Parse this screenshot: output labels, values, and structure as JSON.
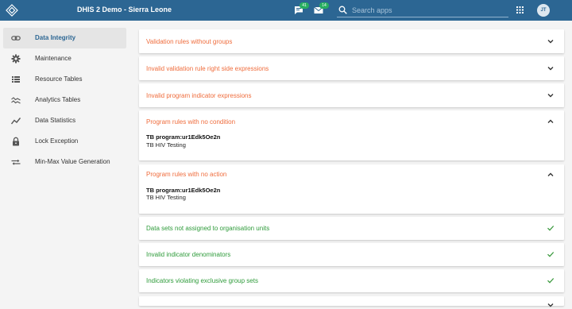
{
  "header": {
    "title": "DHIS 2 Demo - Sierra Leone",
    "messages_count": "41",
    "interpretations_count": "14",
    "search_placeholder": "Search apps",
    "user_initials": "JT"
  },
  "sidebar": {
    "items": [
      {
        "label": "Data Integrity",
        "icon": "link-icon",
        "active": true
      },
      {
        "label": "Maintenance",
        "icon": "gear-icon"
      },
      {
        "label": "Resource Tables",
        "icon": "list-icon"
      },
      {
        "label": "Analytics Tables",
        "icon": "trending-icon"
      },
      {
        "label": "Data Statistics",
        "icon": "chart-line-icon"
      },
      {
        "label": "Lock Exception",
        "icon": "lock-icon"
      },
      {
        "label": "Min-Max Value Generation",
        "icon": "compare-arrows-icon"
      }
    ]
  },
  "checks": [
    {
      "title": "Validation rules without groups",
      "status": "error",
      "expanded": false
    },
    {
      "title": "Invalid validation rule right side expressions",
      "status": "error",
      "expanded": false
    },
    {
      "title": "Invalid program indicator expressions",
      "status": "error",
      "expanded": false
    },
    {
      "title": "Program rules with no condition",
      "status": "error",
      "expanded": true,
      "details": [
        {
          "code": "TB program:ur1Edk5Oe2n",
          "name": "TB HIV Testing"
        }
      ]
    },
    {
      "title": "Program rules with no action",
      "status": "error",
      "expanded": true,
      "details": [
        {
          "code": "TB program:ur1Edk5Oe2n",
          "name": "TB HIV Testing"
        }
      ]
    },
    {
      "title": "Data sets not assigned to organisation units",
      "status": "ok"
    },
    {
      "title": "Invalid indicator denominators",
      "status": "ok"
    },
    {
      "title": "Indicators violating exclusive group sets",
      "status": "ok"
    }
  ],
  "colors": {
    "header_bg": "#2c6693",
    "error_text": "#ef6c3c",
    "ok_text": "#2e9b3a",
    "badge": "#27ae60"
  }
}
